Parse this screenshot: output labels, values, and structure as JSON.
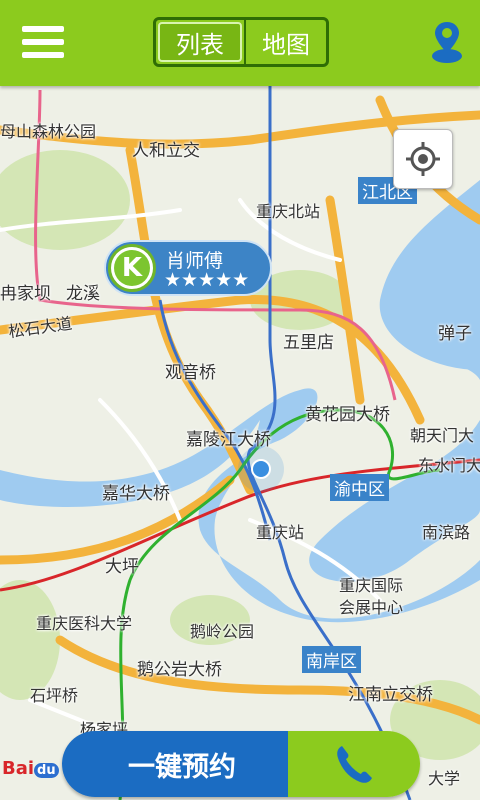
{
  "header": {
    "tabs": [
      {
        "label": "列表",
        "active": true
      },
      {
        "label": "地图",
        "active": false
      }
    ],
    "menu_icon": "hamburger-menu-icon",
    "right_icon": "location-pin-icon"
  },
  "colors": {
    "header_bg": "#8ccb1e",
    "accent_blue": "#1b6cc2",
    "river": "#9fcbf0"
  },
  "map": {
    "labels": {
      "nanshan_park": "母山森林公园",
      "renhe": "人和立交",
      "cq_north": "重庆北站",
      "jiangbei": "江北区",
      "family_dam": "冉家坝",
      "longxi": "龙溪",
      "songshi": "松石大道",
      "wulidian": "五里店",
      "danzi": "弹子",
      "guanyin": "观音桥",
      "huanghuayuan": "黄花园大桥",
      "chaotianmen": "朝天门大",
      "jialing": "嘉陵江大桥",
      "dongshuimen": "东水门大",
      "jiahua": "嘉华大桥",
      "yuzhong": "渝中区",
      "nanbin": "南滨路",
      "cq_station": "重庆站",
      "daping": "大坪",
      "expo": "重庆国际",
      "expo2": "会展中心",
      "medical": "重庆医科大学",
      "eling": "鹅岭公园",
      "nanan": "南岸区",
      "egongyan": "鹅公岩大桥",
      "shiping": "石坪桥",
      "jiangnan": "江南立交桥",
      "yangjiaping": "杨家坪",
      "university": "大学"
    }
  },
  "driver": {
    "name": "肖师傅",
    "badge": "K",
    "rating_text": "★★★★★",
    "rating": 5
  },
  "bottom": {
    "book_label": "一键预约",
    "phone_icon": "phone-icon"
  },
  "watermark": {
    "brand": "Bai",
    "du": "du"
  }
}
